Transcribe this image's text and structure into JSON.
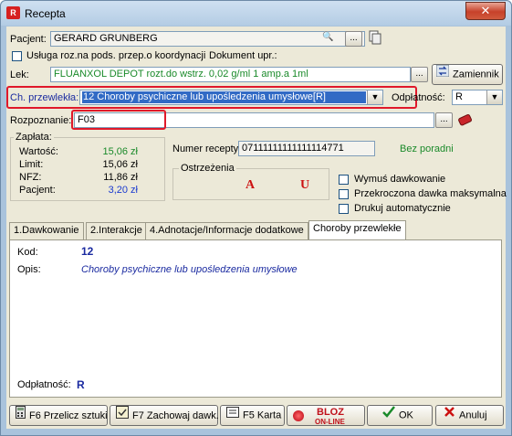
{
  "window": {
    "title": "Recepta",
    "app_icon_text": "R"
  },
  "pacjent": {
    "label": "Pacjent:",
    "value": "GERARD GRUNBERG"
  },
  "usluga": {
    "label": "Usługa roz.na pods. przep.o koordynacji",
    "doc_label": "Dokument upr.:"
  },
  "lek": {
    "label": "Lek:",
    "value": "FLUANXOL DEPOT rozt.do wstrz. 0,02 g/ml 1 amp.a 1ml",
    "zamiennik": "Zamiennik"
  },
  "choroba": {
    "label": "Ch. przewlekła:",
    "value": "12 Choroby psychiczne lub upośledzenia umysłowe[R]"
  },
  "odplatnosc": {
    "label": "Odpłatność:",
    "value": "R"
  },
  "rozpoznanie": {
    "label": "Rozpoznanie:",
    "value": "F03"
  },
  "zaplata": {
    "title": "Zapłata:",
    "rows": [
      {
        "label": "Wartość:",
        "value": "15,06 zł",
        "color": "#1a8a2a"
      },
      {
        "label": "Limit:",
        "value": "15,06 zł",
        "color": "#000000"
      },
      {
        "label": "NFZ:",
        "value": "11,86 zł",
        "color": "#000000"
      },
      {
        "label": "Pacjent:",
        "value": "3,20 zł",
        "color": "#1a3ad0"
      }
    ]
  },
  "numer_recepty": {
    "label": "Numer recepty:",
    "value": "07111111111111114771",
    "bez_poradni": "Bez poradni"
  },
  "ostrzezenia": {
    "title": "Ostrzeżenia",
    "a": "A",
    "u": "U"
  },
  "options": {
    "wymus": "Wymuś dawkowanie",
    "przekroczona": "Przekroczona dawka maksymalna",
    "drukuj": "Drukuj automatycznie"
  },
  "tabs": [
    {
      "label": "1.Dawkowanie"
    },
    {
      "label": "2.Interakcje"
    },
    {
      "label": "4.Adnotacje/Informacje dodatkowe"
    },
    {
      "label": "Choroby przewlekłe"
    }
  ],
  "panel": {
    "kod_label": "Kod:",
    "kod_value": "12",
    "opis_label": "Opis:",
    "opis_value": "Choroby psychiczne lub upośledzenia umysłowe",
    "odpl_label": "Odpłatność:",
    "odpl_value": "R"
  },
  "buttons": {
    "przelicz": "F6 Przelicz sztuki",
    "zachowaj": "F7 Zachowaj dawk.",
    "karta": "F5 Karta",
    "bloz": "BLOZ",
    "bloz_sub": "ON-LINE",
    "ok": "OK",
    "anuluj": "Anuluj"
  },
  "colors": {
    "selection": "#316ac5",
    "accent_red": "#e0182a",
    "green_text": "#1a8a2a",
    "warn_red": "#cc1111"
  }
}
